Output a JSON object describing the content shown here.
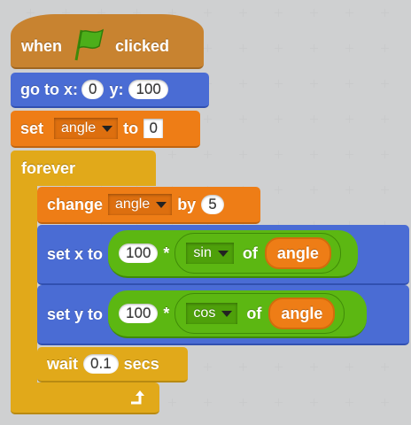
{
  "hat": {
    "when_label": "when",
    "flag_icon": "green-flag-icon",
    "clicked_label": "clicked"
  },
  "go_to": {
    "label_go": "go to x:",
    "x_value": "0",
    "label_y": "y:",
    "y_value": "100"
  },
  "set_angle": {
    "label_set": "set",
    "variable": "angle",
    "label_to": "to",
    "value": "0"
  },
  "forever": {
    "label": "forever",
    "loop_icon": "loop-arrow-icon"
  },
  "change_angle": {
    "label_change": "change",
    "variable": "angle",
    "label_by": "by",
    "value": "5"
  },
  "set_x": {
    "label": "set x to",
    "multiplier": "100",
    "operator": "*",
    "func": "sin",
    "of_label": "of",
    "reporter": "angle"
  },
  "set_y": {
    "label": "set y to",
    "multiplier": "100",
    "operator": "*",
    "func": "cos",
    "of_label": "of",
    "reporter": "angle"
  },
  "wait": {
    "label_wait": "wait",
    "value": "0.1",
    "label_secs": "secs"
  },
  "colors": {
    "events": "#c88330",
    "motion": "#4a6cd4",
    "variables": "#ee7d16",
    "control": "#e1a91a",
    "operators": "#5cb712",
    "background": "#e2e3e4"
  }
}
